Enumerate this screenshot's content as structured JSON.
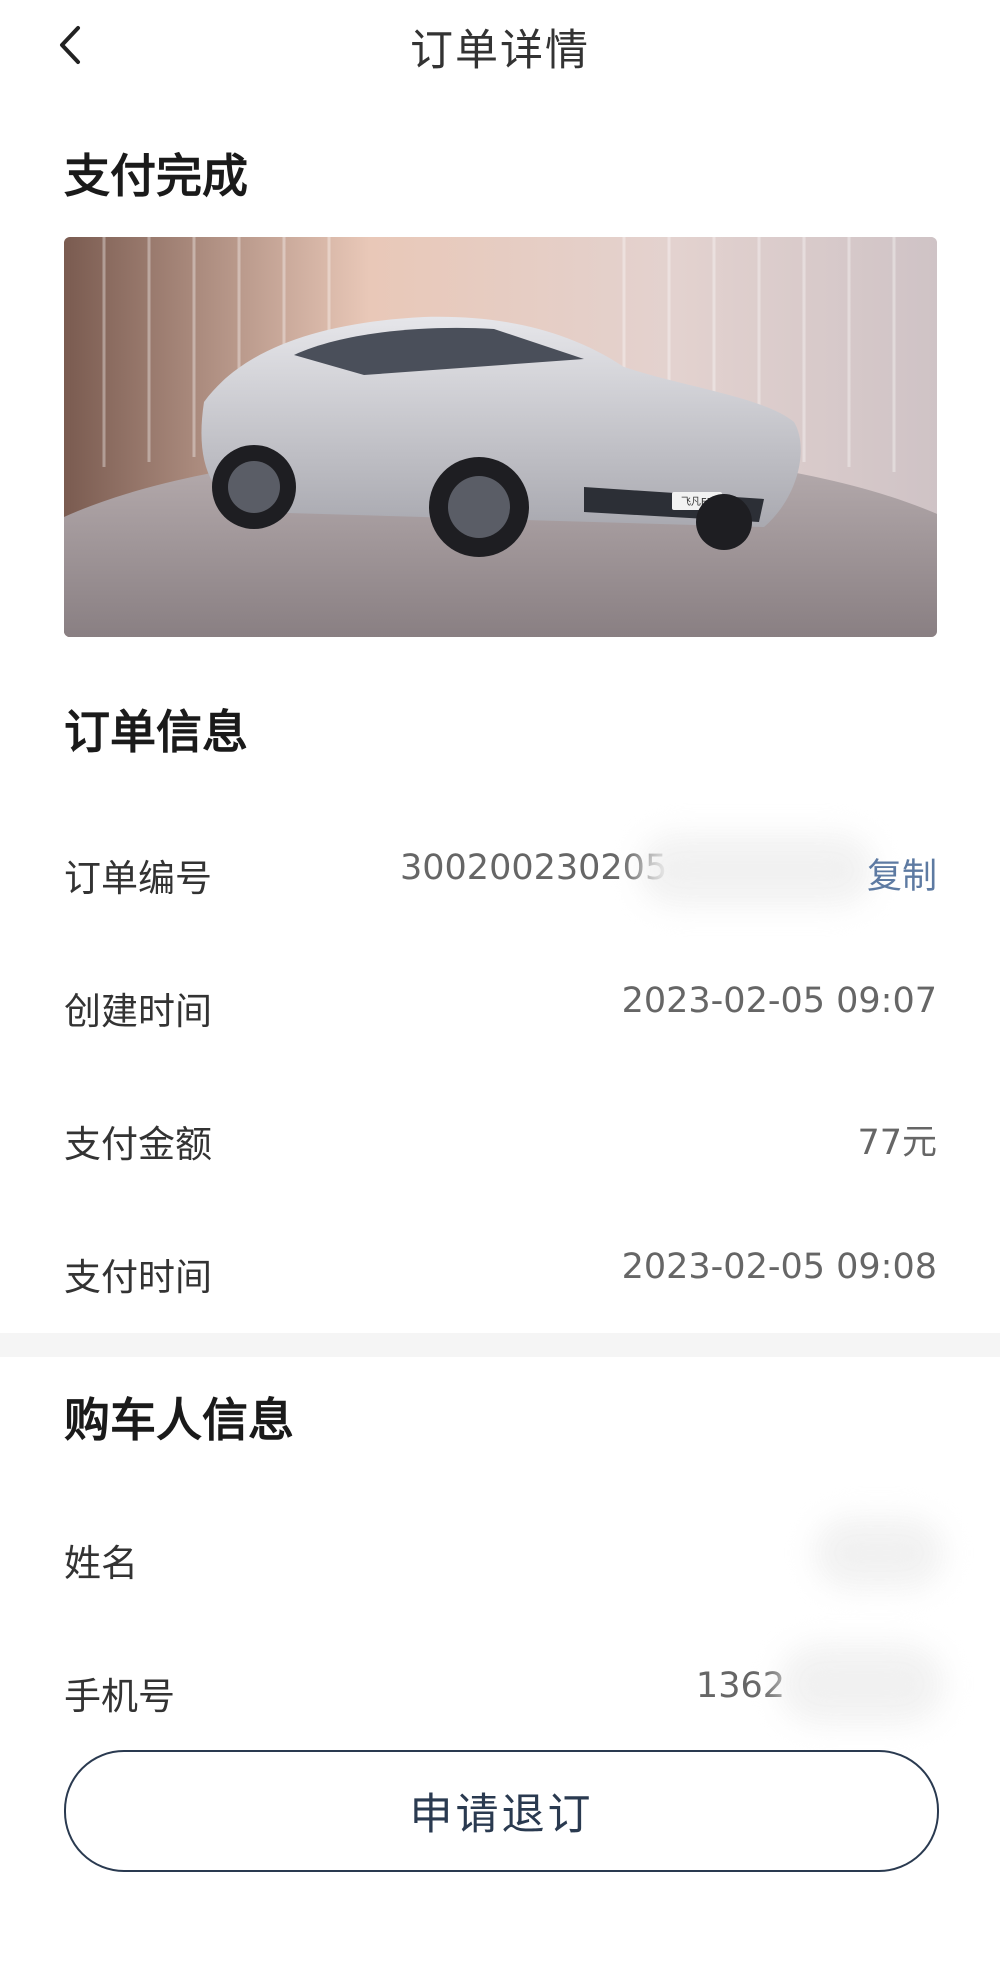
{
  "nav": {
    "title": "订单详情"
  },
  "status": {
    "heading": "支付完成"
  },
  "car_image": {
    "plate_text": "飞凡F7"
  },
  "order_info": {
    "heading": "订单信息",
    "order_number_label": "订单编号",
    "order_number_value": "300200230205",
    "copy_label": "复制",
    "created_time_label": "创建时间",
    "created_time_value": "2023-02-05 09:07",
    "amount_label": "支付金额",
    "amount_value": "77元",
    "pay_time_label": "支付时间",
    "pay_time_value": "2023-02-05 09:08"
  },
  "buyer_info": {
    "heading": "购车人信息",
    "name_label": "姓名",
    "name_value": "",
    "phone_label": "手机号",
    "phone_value": "1362"
  },
  "actions": {
    "refund_label": "申请退订"
  },
  "icons": {
    "back": "chevron-left-icon"
  },
  "colors": {
    "link": "#5d7aa2",
    "button_border": "#2a3a50",
    "divider": "#f5f5f5"
  }
}
